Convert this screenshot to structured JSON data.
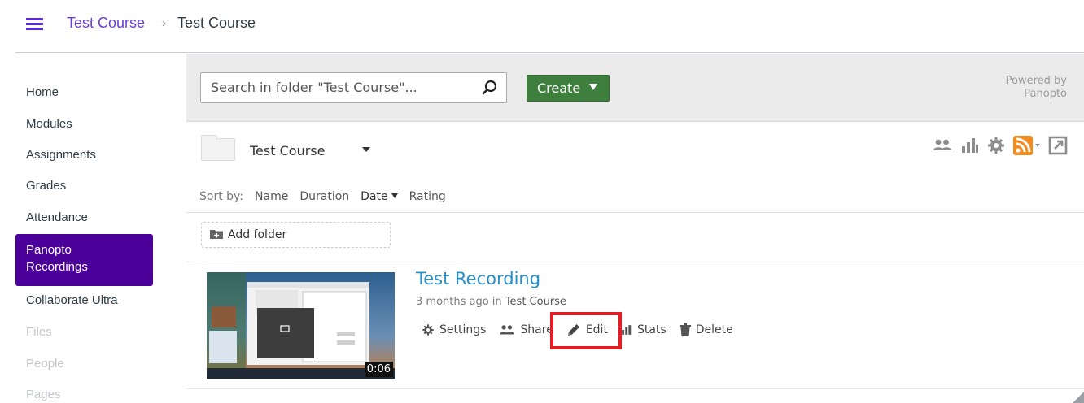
{
  "breadcrumb": {
    "course_link": "Test Course",
    "separator": "›",
    "current": "Test Course"
  },
  "course_nav": {
    "items": [
      {
        "label": "Home",
        "state": "normal"
      },
      {
        "label": "Modules",
        "state": "normal"
      },
      {
        "label": "Assignments",
        "state": "normal"
      },
      {
        "label": "Grades",
        "state": "normal"
      },
      {
        "label": "Attendance",
        "state": "normal"
      },
      {
        "label": "Panopto\nRecordings",
        "state": "active"
      },
      {
        "label": "Collaborate Ultra",
        "state": "normal"
      },
      {
        "label": "Files",
        "state": "disabled"
      },
      {
        "label": "People",
        "state": "disabled"
      },
      {
        "label": "Pages",
        "state": "disabled"
      }
    ]
  },
  "panopto": {
    "search_placeholder": "Search in folder \"Test Course\"...",
    "create_label": "Create",
    "powered_line1": "Powered by",
    "powered_line2": "Panopto",
    "folder_name": "Test Course",
    "toolbar_icons": [
      "users-icon",
      "stats-icon",
      "settings-gear-icon",
      "rss-feed-icon",
      "open-external-icon"
    ],
    "sort": {
      "label": "Sort by:",
      "options": [
        "Name",
        "Duration",
        "Date",
        "Rating"
      ],
      "active": "Date"
    },
    "add_folder_label": "Add folder",
    "session": {
      "title": "Test Recording",
      "meta_prefix": "3 months ago in",
      "meta_folder": "Test Course",
      "duration": "0:06",
      "actions": {
        "settings": "Settings",
        "share": "Share",
        "edit": "Edit",
        "stats": "Stats",
        "delete": "Delete"
      }
    }
  },
  "colors": {
    "brand_purple": "#4b0099",
    "link_purple": "#6b3fd6",
    "create_green": "#3f7f3e",
    "title_blue": "#2a8fc7",
    "rss_orange": "#f28c1e",
    "highlight_red": "#e11d25"
  }
}
